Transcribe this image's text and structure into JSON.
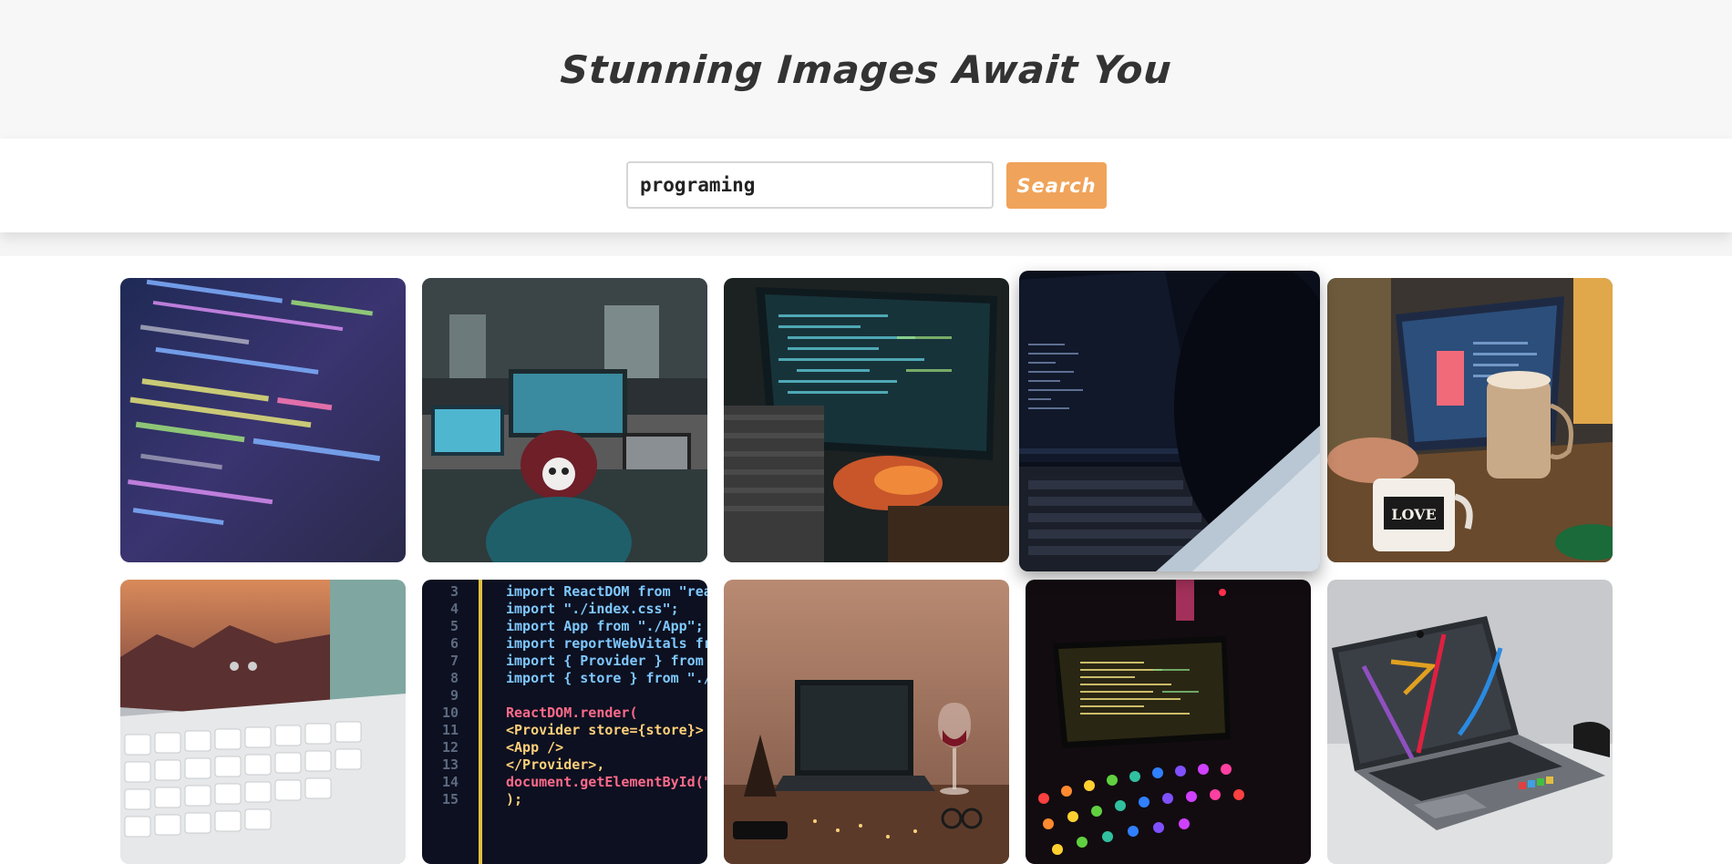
{
  "header": {
    "title": "Stunning Images Await You"
  },
  "search": {
    "value": "programing",
    "placeholder": "",
    "button_label": "Search"
  },
  "colors": {
    "header_bg": "#f7f7f7",
    "accent": "#f0a35a"
  },
  "gallery": {
    "images": [
      {
        "name": "code-closeup-purple-image"
      },
      {
        "name": "hacker-skull-hat-office-image"
      },
      {
        "name": "laptop-code-dark-hands-image"
      },
      {
        "name": "laptop-code-dark-over-shoulder-image"
      },
      {
        "name": "laptop-coffee-mugs-image"
      },
      {
        "name": "macbook-keyboard-image"
      },
      {
        "name": "react-code-editor-image"
      },
      {
        "name": "laptop-wine-glass-table-image"
      },
      {
        "name": "laptop-rgb-keyboard-image"
      },
      {
        "name": "laptop-gray-desk-image"
      }
    ],
    "code_snippet": [
      {
        "n": "3",
        "text": "import ReactDOM from \"react-dom\";"
      },
      {
        "n": "4",
        "text": "import \"./index.css\";"
      },
      {
        "n": "5",
        "text": "import App from \"./App\";"
      },
      {
        "n": "6",
        "text": "import reportWebVitals from \"./reportW"
      },
      {
        "n": "7",
        "text": "import { Provider } from \"react-redu"
      },
      {
        "n": "8",
        "text": "import { store } from \"./store\";"
      },
      {
        "n": "9",
        "text": ""
      },
      {
        "n": "10",
        "text": "ReactDOM.render("
      },
      {
        "n": "11",
        "text": "  <Provider store={store}>"
      },
      {
        "n": "12",
        "text": "    <App />"
      },
      {
        "n": "13",
        "text": "  </Provider>,"
      },
      {
        "n": "14",
        "text": "  document.getElementById(\"root\""
      },
      {
        "n": "15",
        "text": ");"
      }
    ],
    "mug_text": "LOVE"
  }
}
